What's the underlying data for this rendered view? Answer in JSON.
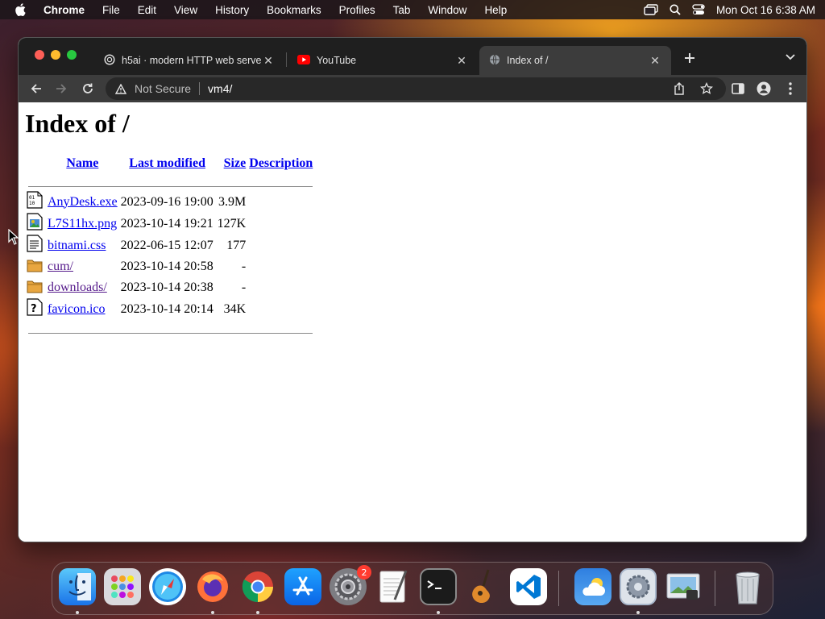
{
  "menubar": {
    "app_name": "Chrome",
    "items": [
      "File",
      "Edit",
      "View",
      "History",
      "Bookmarks",
      "Profiles",
      "Tab",
      "Window",
      "Help"
    ],
    "clock": "Mon Oct 16  6:38 AM"
  },
  "tabs": [
    {
      "title": "h5ai · modern HTTP web serve",
      "icon": "globe-icon",
      "active": false
    },
    {
      "title": "YouTube",
      "icon": "youtube-icon",
      "active": false
    },
    {
      "title": "Index of /",
      "icon": "globe-icon",
      "active": true
    }
  ],
  "toolbar": {
    "security_label": "Not Secure",
    "url": "vm4/"
  },
  "page": {
    "heading": "Index of /",
    "columns": {
      "name": "Name",
      "last_modified": "Last modified",
      "size": "Size",
      "description": "Description"
    },
    "rows": [
      {
        "name": "AnyDesk.exe",
        "modified": "2023-09-16 19:00",
        "size": "3.9M",
        "icon": "binary-file-icon"
      },
      {
        "name": "L7S11hx.png",
        "modified": "2023-10-14 19:21",
        "size": "127K",
        "icon": "image-file-icon"
      },
      {
        "name": "bitnami.css",
        "modified": "2022-06-15 12:07",
        "size": "177",
        "icon": "text-file-icon"
      },
      {
        "name": "cum/",
        "modified": "2023-10-14 20:58",
        "size": "-",
        "icon": "folder-icon"
      },
      {
        "name": "downloads/",
        "modified": "2023-10-14 20:38",
        "size": "-",
        "icon": "folder-icon"
      },
      {
        "name": "favicon.ico",
        "modified": "2023-10-14 20:14",
        "size": "34K",
        "icon": "unknown-file-icon"
      }
    ]
  },
  "dock": {
    "apps": [
      "finder",
      "launchpad",
      "safari",
      "firefox",
      "chrome",
      "app-store",
      "system-settings",
      "textedit",
      "terminal",
      "garageband",
      "vscode",
      "weather",
      "system-preferences",
      "preview",
      "trash"
    ],
    "system_settings_badge": "2"
  },
  "colors": {
    "link": "#0000ee",
    "visited_link": "#551a8b",
    "tab_strip": "#1f1f1f",
    "toolbar": "#3c3c3c"
  }
}
